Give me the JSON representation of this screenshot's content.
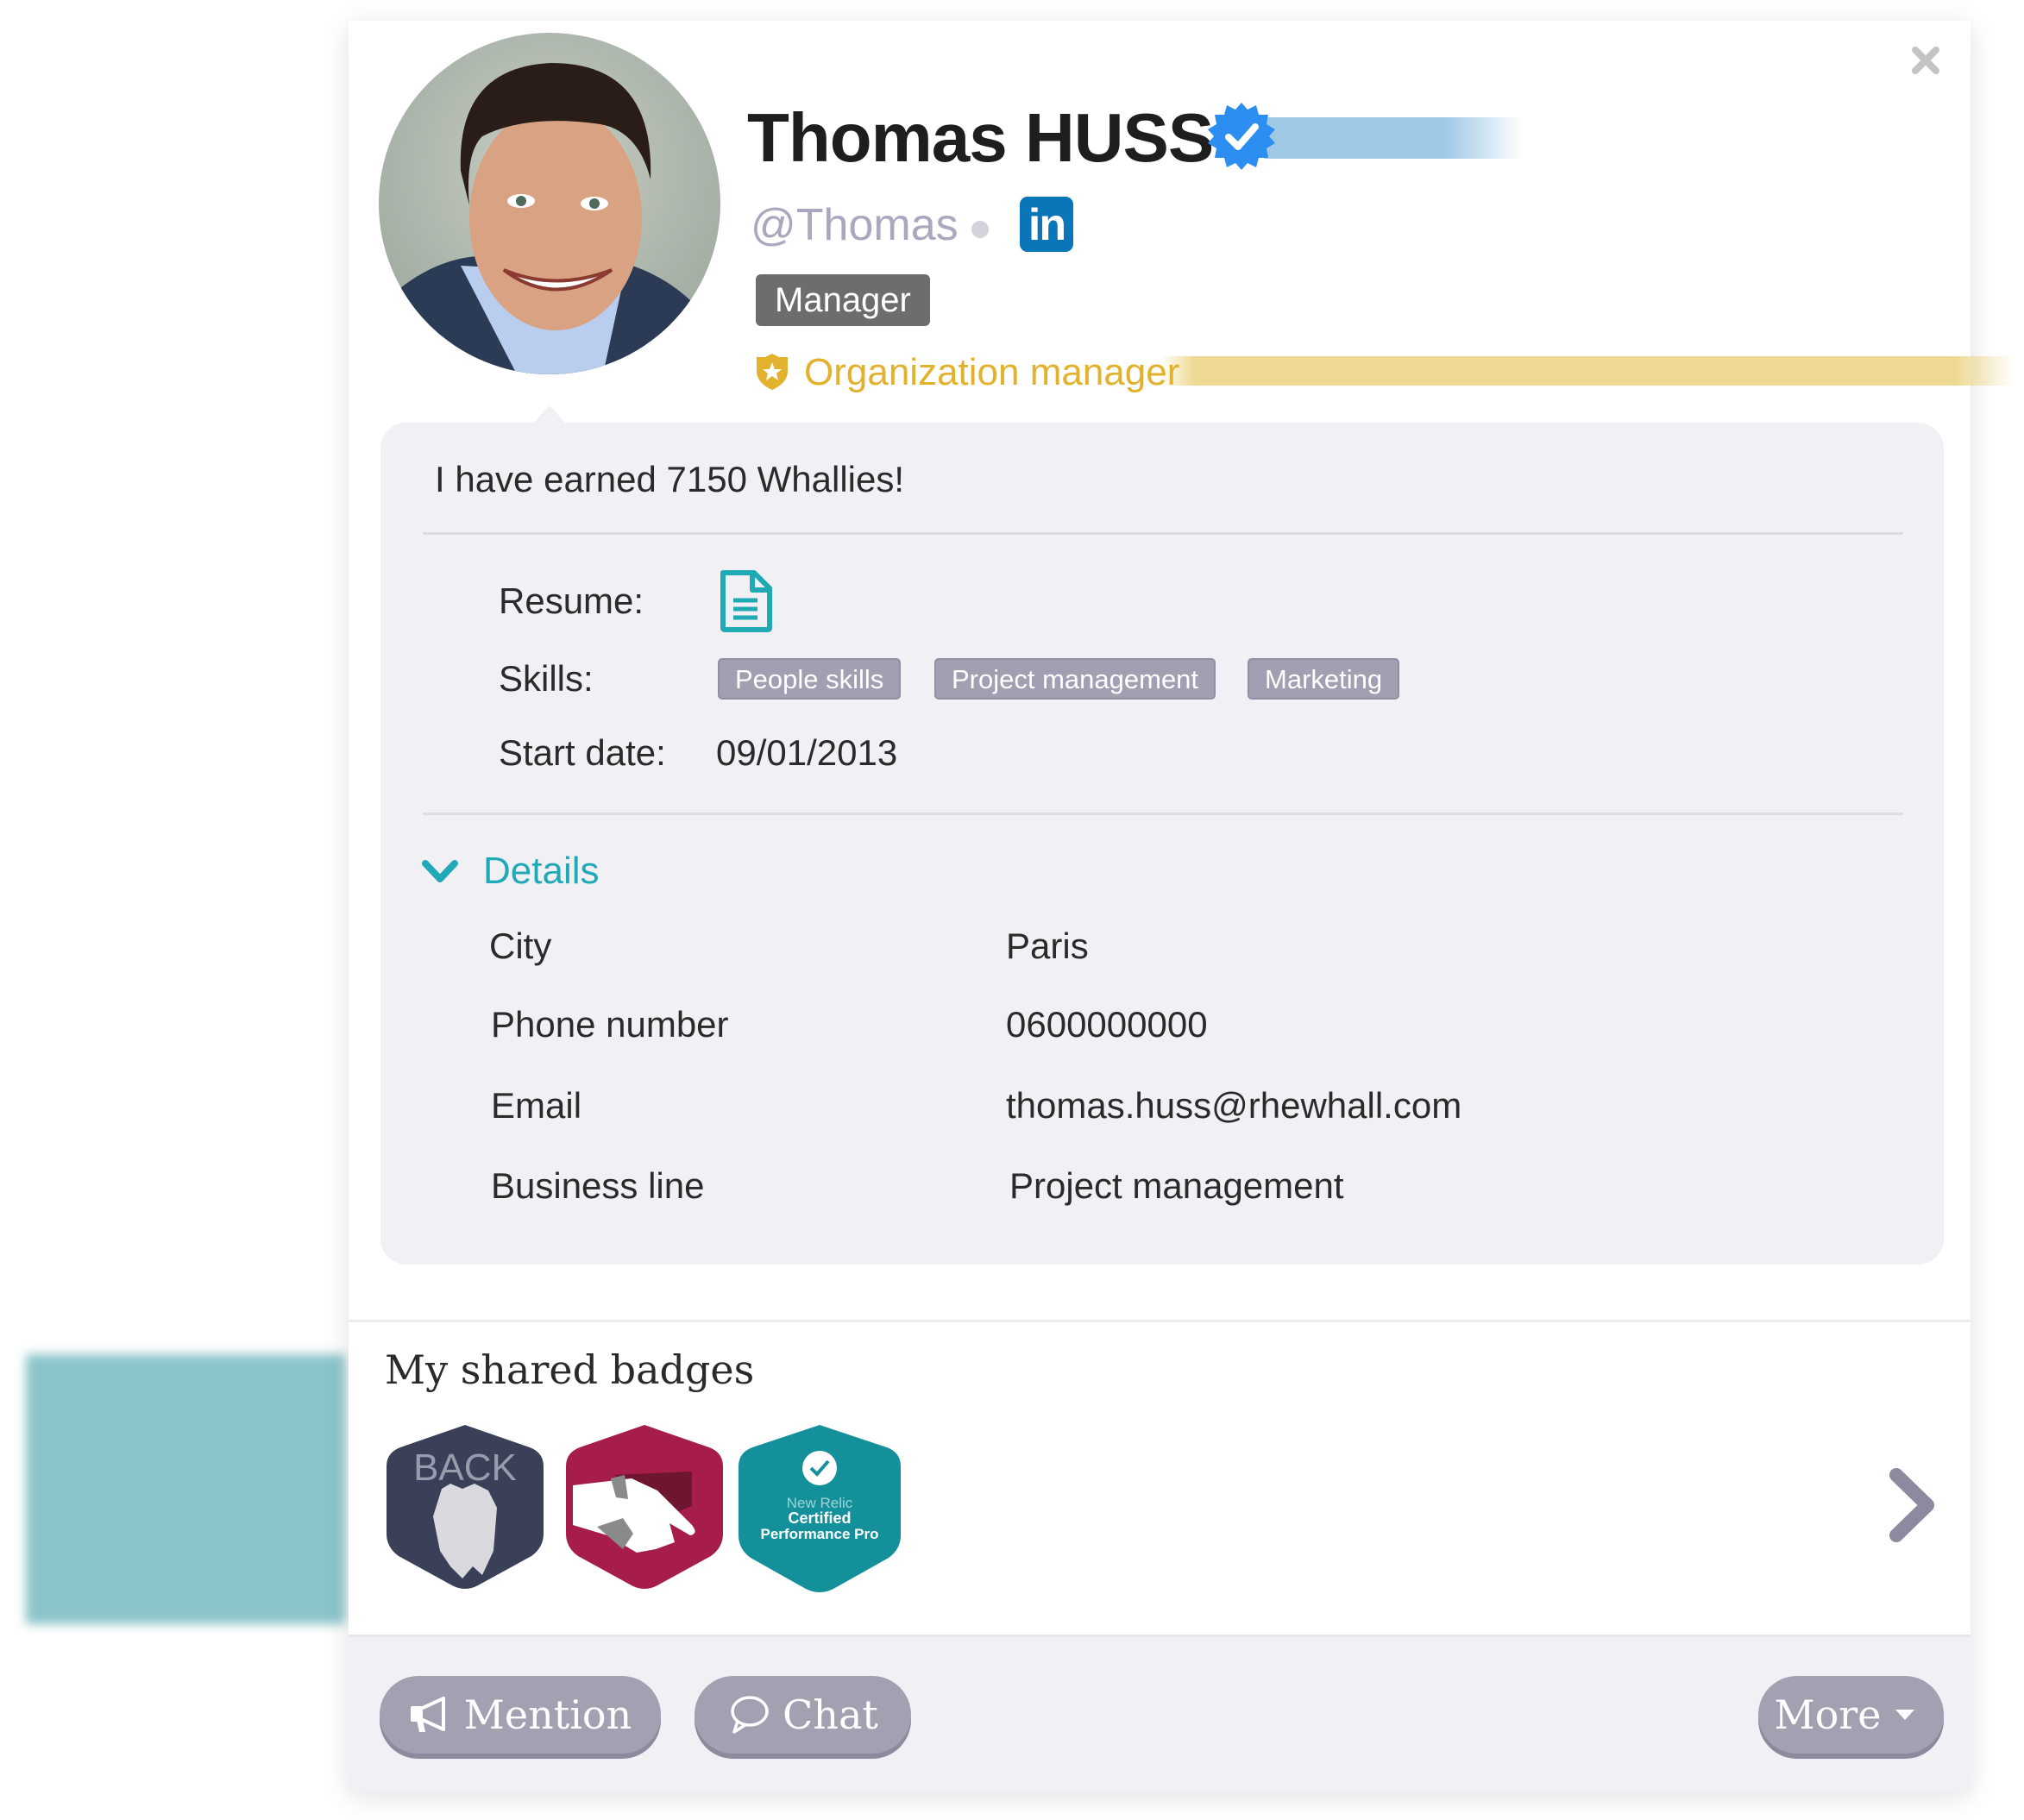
{
  "profile": {
    "name": "Thomas HUSS",
    "handle": "@Thomas",
    "verified": true,
    "role_tag": "Manager",
    "org_role": "Organization manager",
    "linkedin_label": "in",
    "colors": {
      "verified": "#2c8ef0",
      "linkedin": "#0a75b8",
      "org_role": "#e2b22e",
      "accent": "#22a9b8"
    }
  },
  "info": {
    "whallies_text": "I have earned 7150 Whallies!",
    "resume_label": "Resume:",
    "skills_label": "Skills:",
    "skills": [
      "People skills",
      "Project management",
      "Marketing"
    ],
    "start_date_label": "Start date:",
    "start_date": "09/01/2013",
    "details_label": "Details",
    "details": [
      {
        "label": "City",
        "value": "Paris"
      },
      {
        "label": "Phone number",
        "value": "0600000000"
      },
      {
        "label": "Email",
        "value": "thomas.huss@rhewhall.com"
      },
      {
        "label": "Business line",
        "value": "Project management"
      }
    ]
  },
  "badges": {
    "title": "My shared badges",
    "items": [
      {
        "name": "back-badge",
        "text": "BACK",
        "color": "#3a4058"
      },
      {
        "name": "handshake-badge",
        "text": "",
        "color": "#a51d48"
      },
      {
        "name": "new-relic-badge",
        "text_lines": [
          "New Relic",
          "Certified",
          "Performance Pro"
        ],
        "color": "#14909a"
      }
    ]
  },
  "actions": {
    "mention": "Mention",
    "chat": "Chat",
    "more": "More"
  }
}
